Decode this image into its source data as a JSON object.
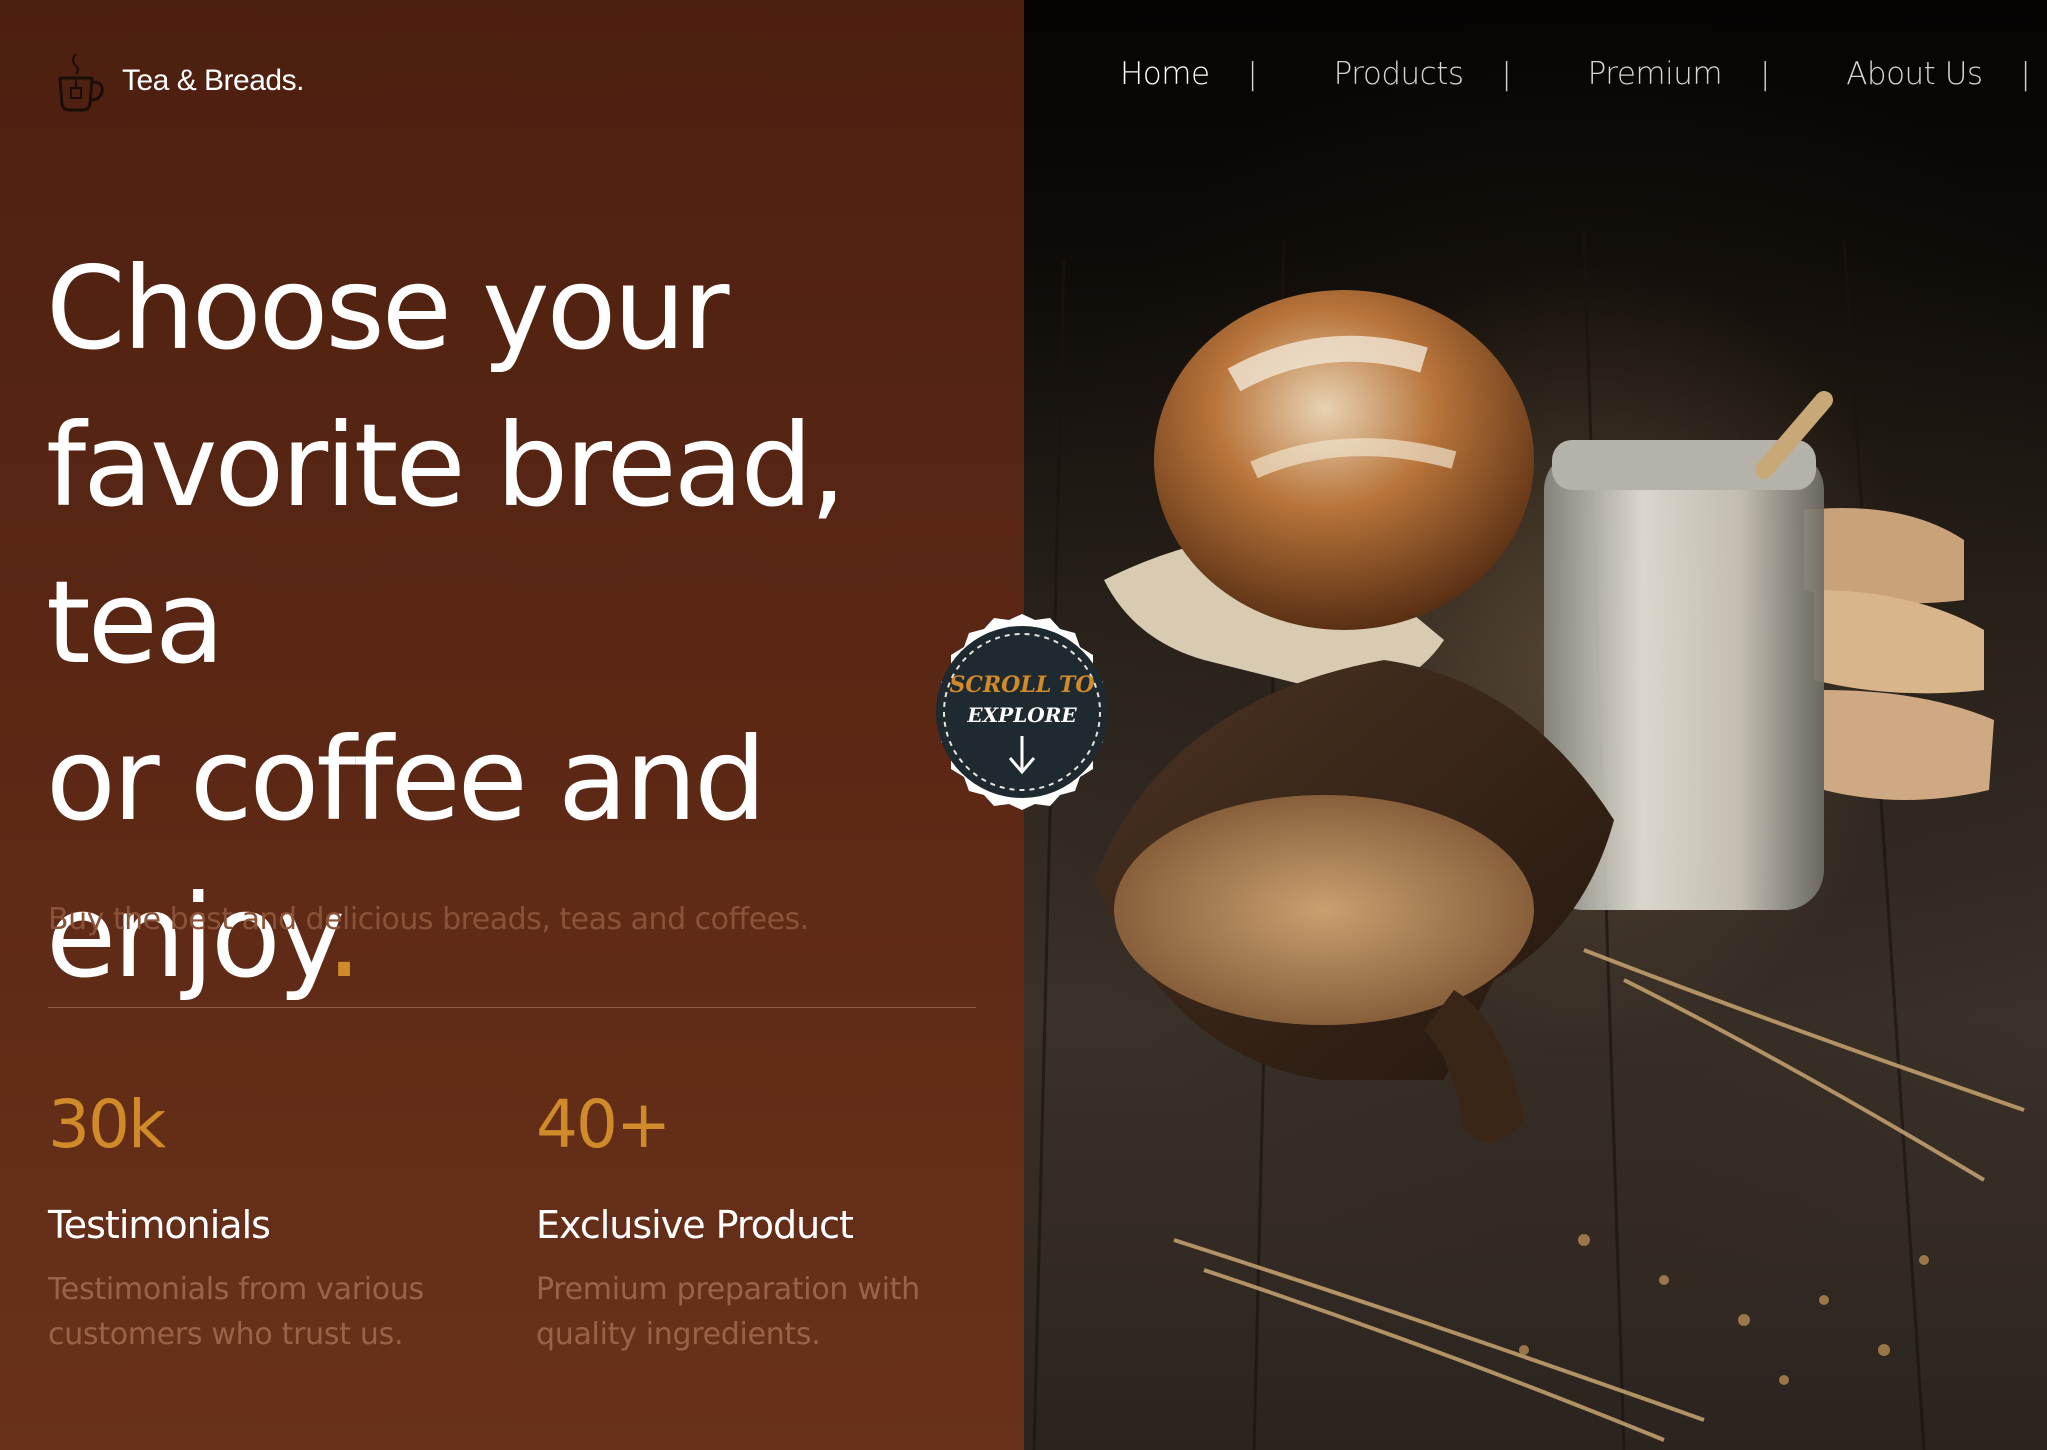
{
  "brand": {
    "name": "Tea & Breads.",
    "logo_icon": "tea-cup-icon"
  },
  "nav": {
    "items": [
      {
        "label": "Home",
        "active": true
      },
      {
        "label": "Products",
        "active": false
      },
      {
        "label": "Premium",
        "active": false
      },
      {
        "label": "About Us",
        "active": false
      }
    ],
    "separator": "|"
  },
  "hero": {
    "headline_lines": [
      "Choose your",
      "favorite bread, tea",
      "or coffee and",
      "enjoy"
    ],
    "headline_dot": ".",
    "subtitle": "Buy the best and delicious breads, teas and coffees."
  },
  "stats": [
    {
      "value": "30k",
      "title": "Testimonials",
      "description": "Testimonials from various customers who trust us."
    },
    {
      "value": "40+",
      "title": "Exclusive Product",
      "description": "Premium preparation with quality ingredients."
    }
  ],
  "scroll_badge": {
    "line1": "SCROLL TO",
    "line2": "EXPLORE",
    "icon": "arrow-down-icon"
  },
  "colors": {
    "panel": "#5a2714",
    "accent": "#d08a2a",
    "text": "#ffffff",
    "muted": "#8a5238"
  }
}
